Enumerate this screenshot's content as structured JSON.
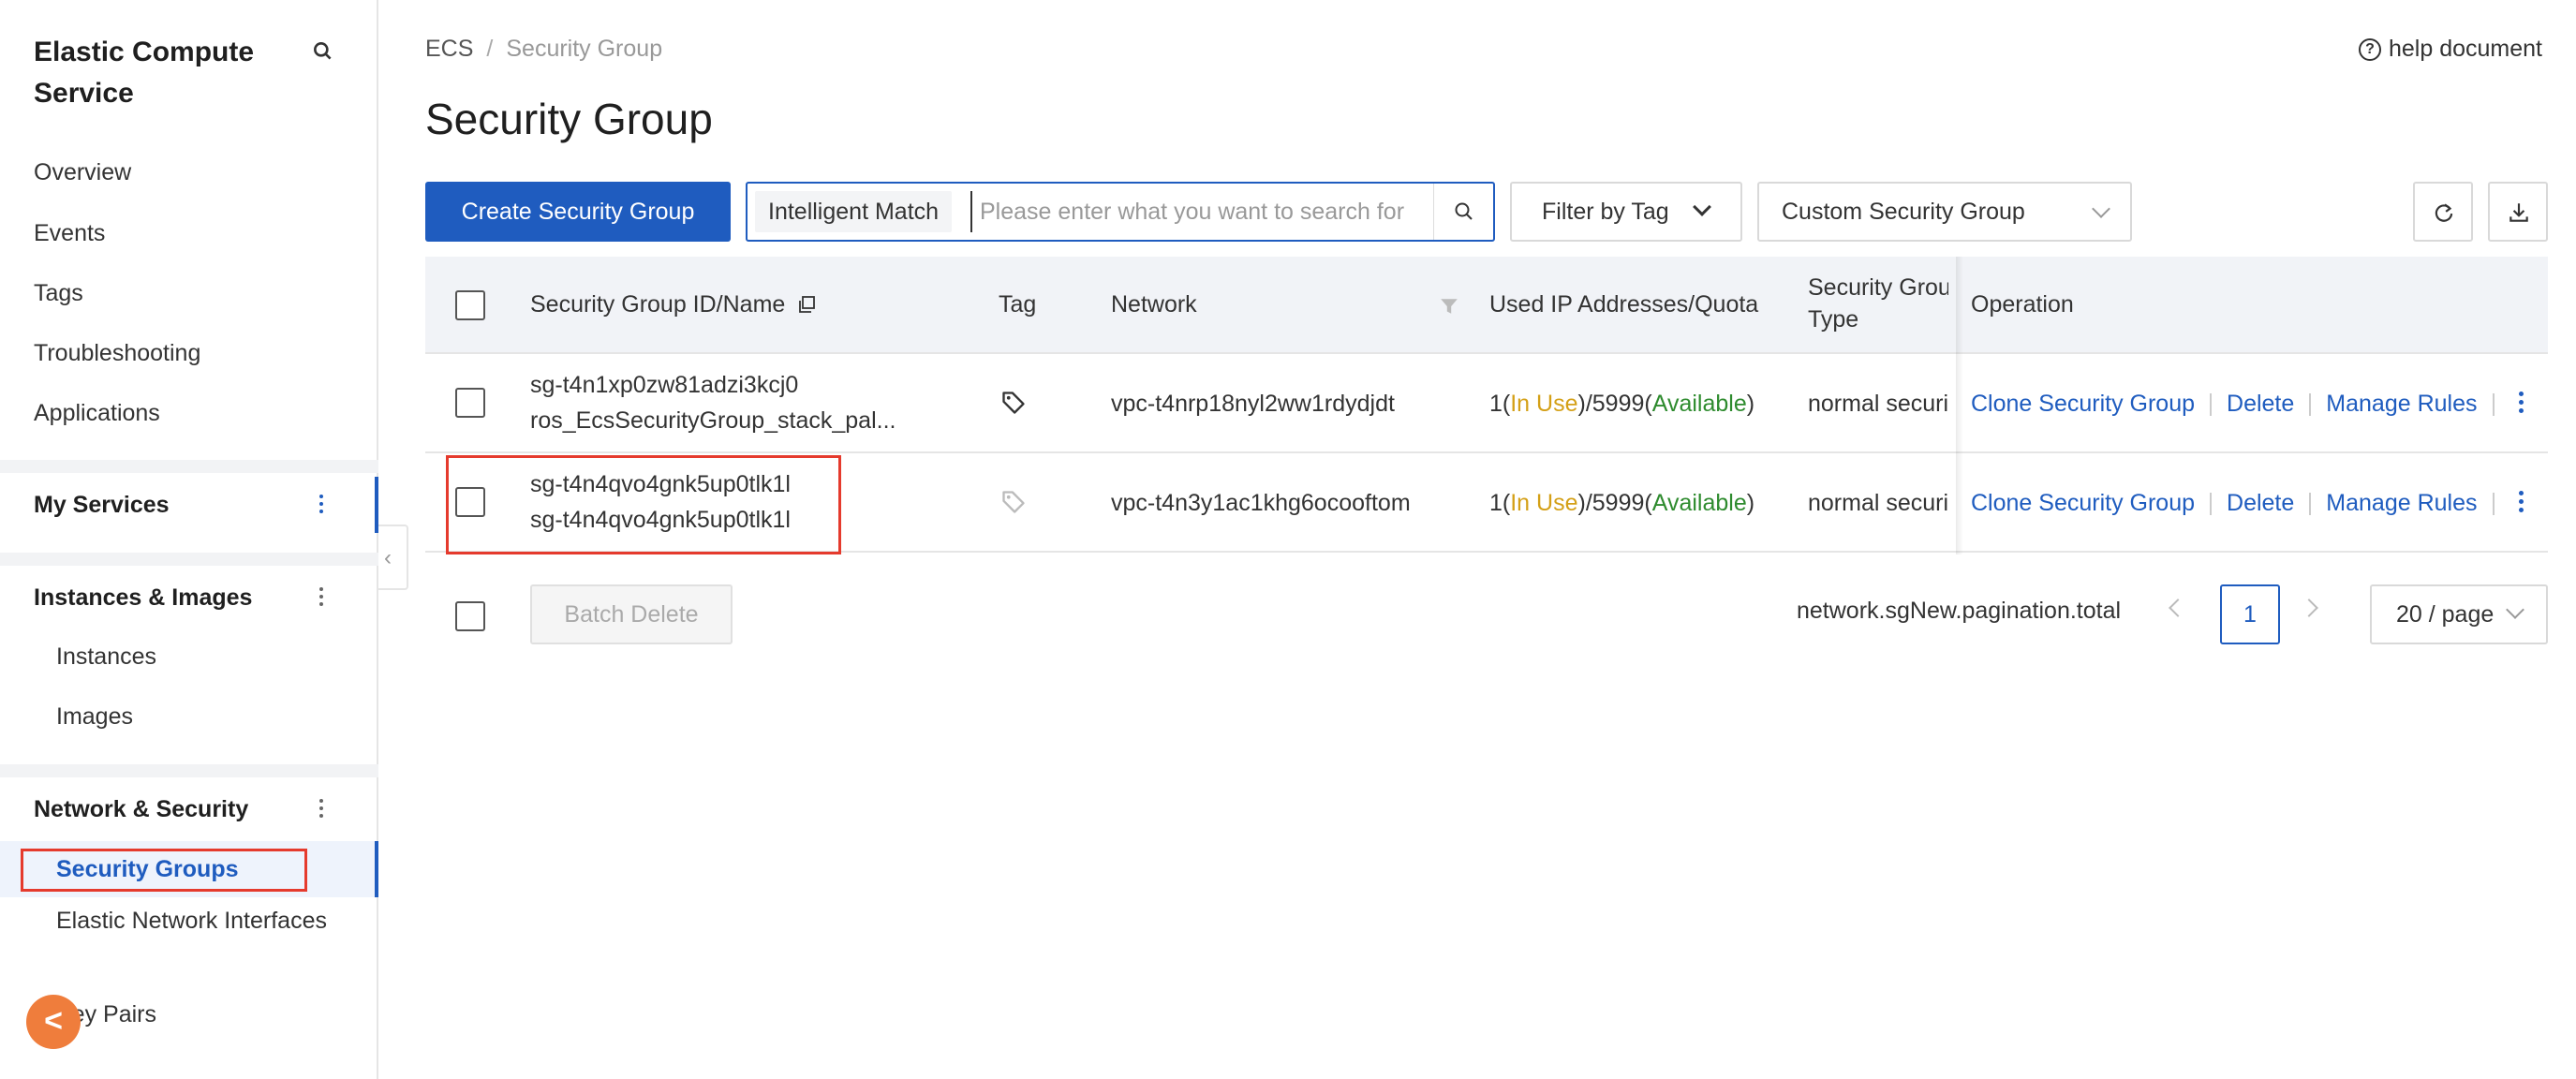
{
  "sidebar": {
    "title": "Elastic Compute Service",
    "items": [
      "Overview",
      "Events",
      "Tags",
      "Troubleshooting",
      "Applications"
    ],
    "my_services": "My Services",
    "instances_images": {
      "label": "Instances & Images",
      "items": [
        "Instances",
        "Images"
      ]
    },
    "network_security": {
      "label": "Network & Security",
      "items": [
        "Security Groups",
        "Elastic Network Interfaces",
        "Key Pairs"
      ]
    },
    "fab_label": "<"
  },
  "breadcrumb": {
    "root": "ECS",
    "sep": "/",
    "current": "Security Group"
  },
  "help": {
    "label": "help document",
    "icon": "?"
  },
  "page_title": "Security Group",
  "toolbar": {
    "create_label": "Create Security Group",
    "search_type": "Intelligent Match",
    "search_placeholder": "Please enter what you want to search for",
    "filter_tag": "Filter by Tag",
    "group_type": "Custom Security Group"
  },
  "table": {
    "headers": {
      "id_name": "Security Group ID/Name",
      "tag": "Tag",
      "network": "Network",
      "used_ip": "Used IP Addresses/Quota",
      "type_line1": "Security Grou",
      "type_line2": "Type",
      "operation": "Operation"
    },
    "rows": [
      {
        "id": "sg-t4n1xp0zw81adzi3kcj0",
        "name": "ros_EcsSecurityGroup_stack_pal...",
        "network": "vpc-t4nrp18nyl2ww1rdydjdt",
        "used_prefix": "1(",
        "in_use": "In Use",
        "mid": ")/5999(",
        "available": "Available",
        "suffix": ")",
        "type": "normal securit",
        "ops": [
          "Clone Security Group",
          "Delete",
          "Manage Rules"
        ]
      },
      {
        "id": "sg-t4n4qvo4gnk5up0tlk1l",
        "name": "sg-t4n4qvo4gnk5up0tlk1l",
        "network": "vpc-t4n3y1ac1khg6ocooftom",
        "used_prefix": "1(",
        "in_use": "In Use",
        "mid": ")/5999(",
        "available": "Available",
        "suffix": ")",
        "type": "normal securit",
        "ops": [
          "Clone Security Group",
          "Delete",
          "Manage Rules"
        ]
      }
    ]
  },
  "footer": {
    "batch_delete": "Batch Delete",
    "pagination_total": "network.sgNew.pagination.total",
    "current_page": "1",
    "page_size": "20 / page"
  },
  "colors": {
    "accent": "#1f5cbf",
    "highlight": "#e53a2d",
    "in_use": "#d4a017",
    "available": "#2e8b2e",
    "fab": "#ef7d3c"
  }
}
